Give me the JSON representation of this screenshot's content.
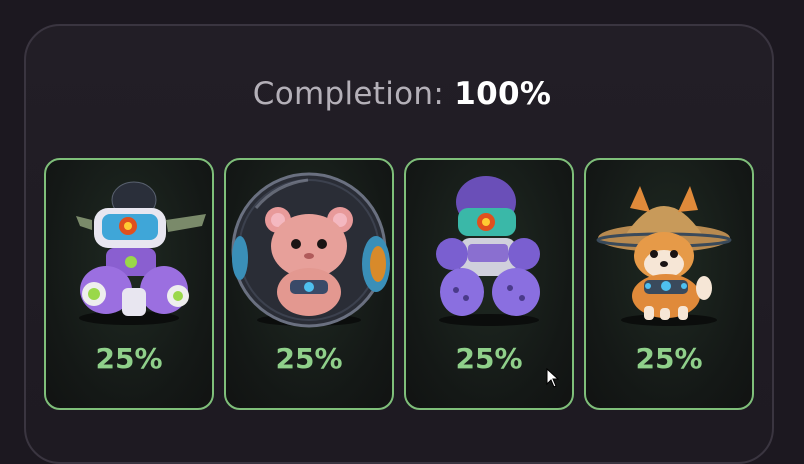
{
  "completion": {
    "label": "Completion:",
    "value": "100%"
  },
  "cards": [
    {
      "name": "robot-mech",
      "percent": "25%",
      "icon": "robot-mech-icon"
    },
    {
      "name": "hamster-ball",
      "percent": "25%",
      "icon": "hamster-in-ball-icon"
    },
    {
      "name": "astronaut-mech",
      "percent": "25%",
      "icon": "astronaut-mech-icon"
    },
    {
      "name": "shiba-straw-hat",
      "percent": "25%",
      "icon": "shiba-dog-hat-icon"
    }
  ],
  "colors": {
    "accent_green": "#8fd08a",
    "card_border": "#7fbf7a",
    "background": "#1c1820"
  }
}
